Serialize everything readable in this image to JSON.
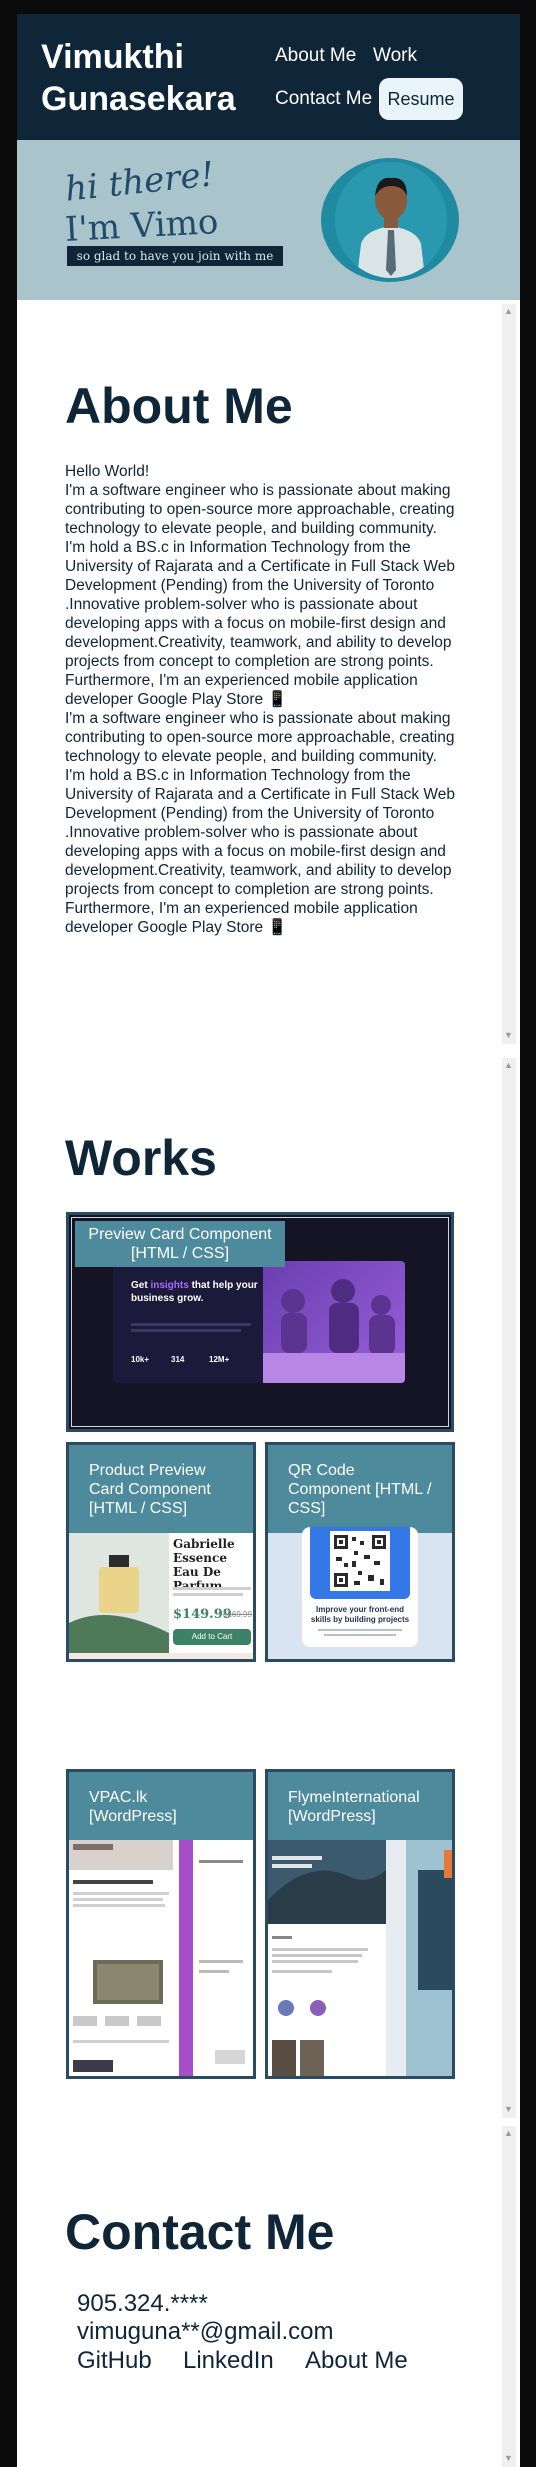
{
  "header": {
    "brand": "Vimukthi Gunasekara",
    "nav": {
      "about": "About Me",
      "work": "Work",
      "contact": "Contact Me"
    },
    "resume_label": "Resume"
  },
  "banner": {
    "greeting": "hi there!",
    "name": "I'm Vimo",
    "tagline": "so glad to have you join with me"
  },
  "about": {
    "title": "About Me",
    "hello": "Hello World!",
    "paragraph": "I'm a software engineer who is passionate about making contributing to open-source more approachable, creating technology to elevate people, and building community. I'm hold a BS.c in Information Technology from the University of Rajarata and a Certificate in Full Stack Web Development (Pending) from the University of Toronto .Innovative problem-solver who is passionate about developing apps with a focus on mobile-first design and development.Creativity, teamwork, and ability to develop projects from concept to completion are strong points. Furthermore, I'm an experienced mobile application developer Google Play Store 📱"
  },
  "works": {
    "title": "Works",
    "featured": {
      "title": "Preview Card Component [HTML / CSS]",
      "preview_heading_a": "Get ",
      "preview_heading_b": "insights",
      "preview_heading_c": " that help your business grow.",
      "stats": [
        "10k+",
        "314",
        "12M+"
      ]
    },
    "cards": [
      {
        "title": "Product Preview Card Component [HTML / CSS]",
        "product_name": "Gabrielle Essence Eau De Parfum",
        "price": "$149.99",
        "old_price": "$169.99",
        "cta": "Add to Cart"
      },
      {
        "title": "QR Code Component [HTML / CSS]",
        "qr_heading": "Improve your front-end skills by building projects"
      },
      {
        "title": "VPAC.lk [WordPress]"
      },
      {
        "title": "FlymeInternational [WordPress]"
      }
    ]
  },
  "contact": {
    "title": "Contact Me",
    "phone": "905.324.****",
    "email": "vimuguna**@gmail.com",
    "links": {
      "github": "GitHub",
      "linkedin": "LinkedIn",
      "about": "About Me"
    }
  },
  "colors": {
    "navy": "#0f2638",
    "teal": "#4d8a9c",
    "banner": "#a9c5cb",
    "accent": "#7b3fc4"
  }
}
